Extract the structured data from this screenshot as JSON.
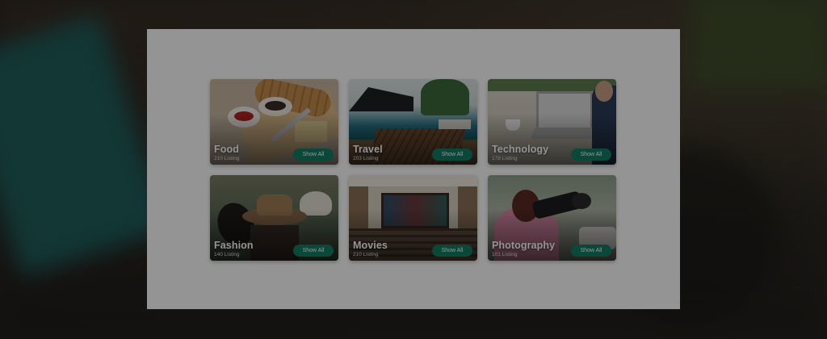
{
  "categories": [
    {
      "title": "Food",
      "count": "210 Listing",
      "button": "Show All",
      "icon": "food-image"
    },
    {
      "title": "Travel",
      "count": "203 Listing",
      "button": "Show All",
      "icon": "travel-image"
    },
    {
      "title": "Technology",
      "count": "178 Listing",
      "button": "Show All",
      "icon": "technology-image"
    },
    {
      "title": "Fashion",
      "count": "140 Listing",
      "button": "Show All",
      "icon": "fashion-image"
    },
    {
      "title": "Movies",
      "count": "210 Listing",
      "button": "Show All",
      "icon": "movies-image"
    },
    {
      "title": "Photography",
      "count": "101 Listing",
      "button": "Show All",
      "icon": "photography-image"
    }
  ],
  "colors": {
    "button": "#127d64",
    "panel": "#ffffff",
    "overlay": "rgba(0,0,0,0.42)"
  }
}
